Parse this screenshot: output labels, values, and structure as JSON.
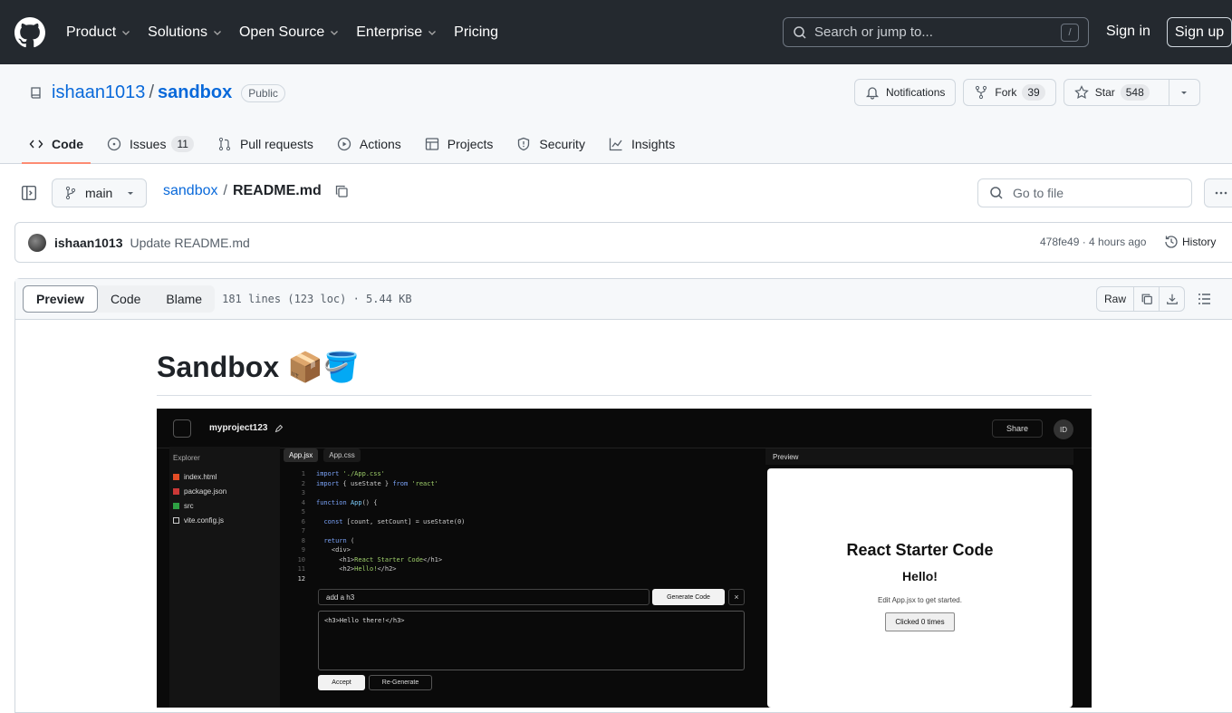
{
  "header": {
    "nav": [
      {
        "label": "Product",
        "chevron": true
      },
      {
        "label": "Solutions",
        "chevron": true
      },
      {
        "label": "Open Source",
        "chevron": true
      },
      {
        "label": "Enterprise",
        "chevron": true
      },
      {
        "label": "Pricing",
        "chevron": false
      }
    ],
    "search_placeholder": "Search or jump to...",
    "search_shortcut": "/",
    "sign_in": "Sign in",
    "sign_up": "Sign up"
  },
  "repo": {
    "owner": "ishaan1013",
    "separator": "/",
    "name": "sandbox",
    "visibility": "Public",
    "notifications_label": "Notifications",
    "fork_label": "Fork",
    "fork_count": "39",
    "star_label": "Star",
    "star_count": "548"
  },
  "tabs": {
    "code": "Code",
    "issues": "Issues",
    "issues_count": "11",
    "pulls": "Pull requests",
    "actions": "Actions",
    "projects": "Projects",
    "security": "Security",
    "insights": "Insights"
  },
  "filebar": {
    "branch": "main",
    "crumb_repo": "sandbox",
    "crumb_sep": "/",
    "crumb_file": "README.md",
    "goto_placeholder": "Go to file"
  },
  "commit": {
    "author": "ishaan1013",
    "message": "Update README.md",
    "meta": "478fe49 · 4 hours ago",
    "history": "History"
  },
  "file": {
    "preview": "Preview",
    "code": "Code",
    "blame": "Blame",
    "info": "181 lines (123 loc) · 5.44 KB",
    "raw": "Raw"
  },
  "readme": {
    "title": "Sandbox 📦🪣"
  },
  "screenshot": {
    "project": "myproject123",
    "share": "Share",
    "avatar": "ID",
    "explorer": "Explorer",
    "files": [
      "index.html",
      "package.json",
      "src",
      "vite.config.js"
    ],
    "tab1": "App.jsx",
    "tab2": "App.css",
    "prompt": "add a h3",
    "generate": "Generate Code",
    "output": "<h3>Hello there!</h3>",
    "accept": "Accept",
    "regenerate": "Re-Generate",
    "preview_label": "Preview",
    "preview_h1": "React Starter Code",
    "preview_h2": "Hello!",
    "preview_p": "Edit App.jsx to get started.",
    "preview_btn": "Clicked 0 times"
  }
}
